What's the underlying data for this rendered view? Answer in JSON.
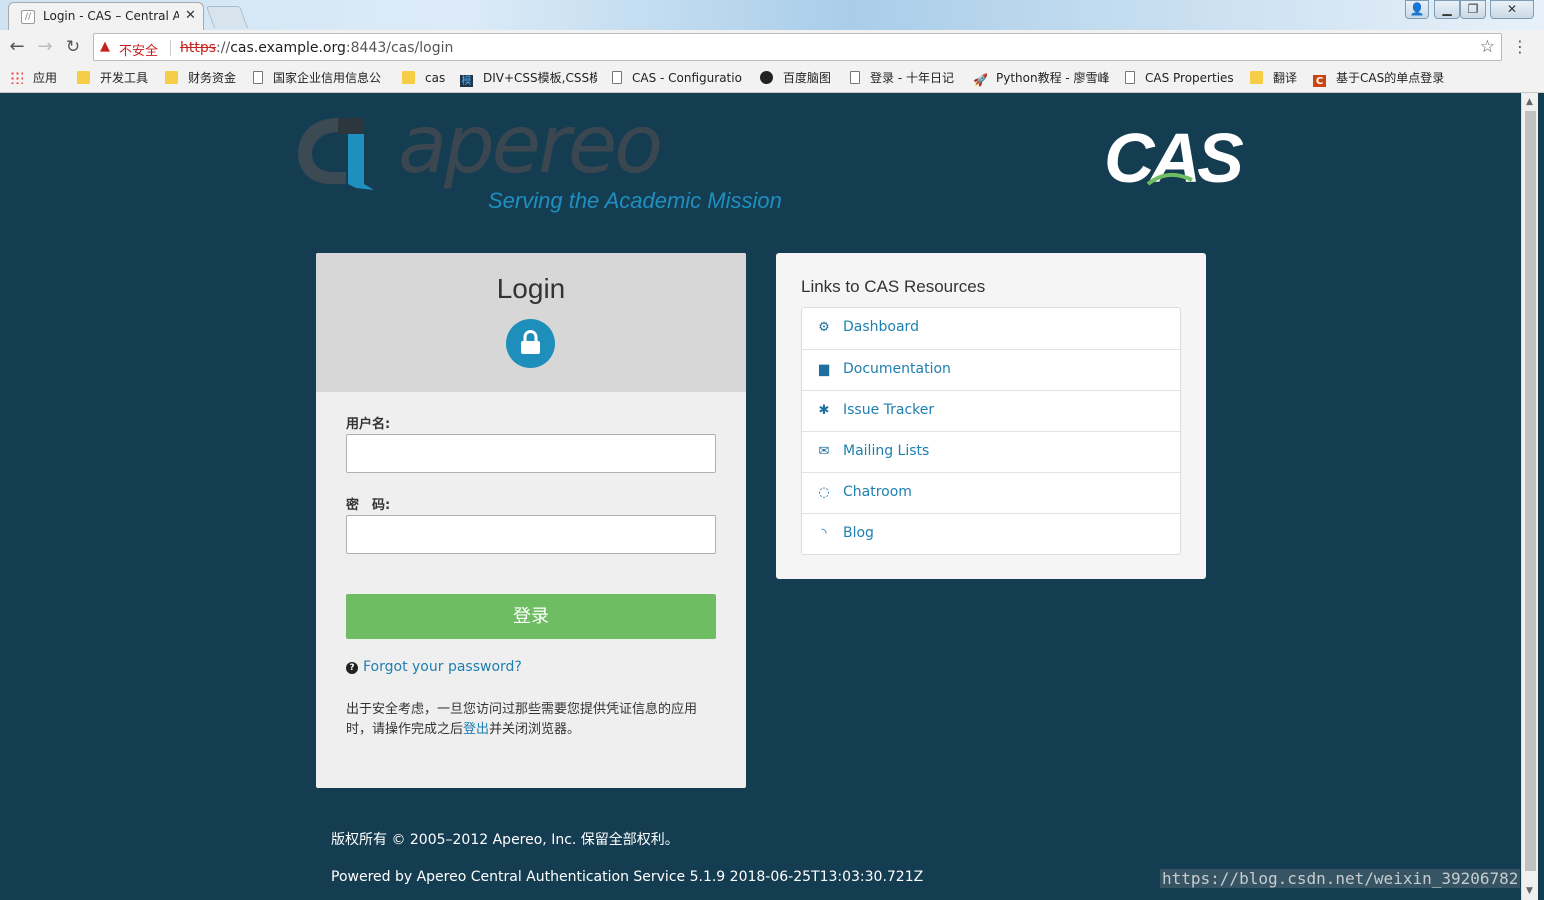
{
  "browser": {
    "tab_title": "Login - CAS – Central A",
    "security_label": "不安全",
    "url_scheme": "https",
    "url_sep": "://",
    "url_host": "cas.example.org",
    "url_rest": ":8443/cas/login",
    "bookmarks": [
      {
        "label": "应用",
        "icon": "apps-icon"
      },
      {
        "label": "开发工具",
        "icon": "folder-icon"
      },
      {
        "label": "财务资金",
        "icon": "folder-icon"
      },
      {
        "label": "国家企业信用信息公",
        "icon": "page-icon"
      },
      {
        "label": "cas",
        "icon": "folder-icon"
      },
      {
        "label": "DIV+CSS模板,CSS模",
        "icon": "template-icon"
      },
      {
        "label": "CAS - Configuratio",
        "icon": "page-icon"
      },
      {
        "label": "百度脑图",
        "icon": "owl-icon"
      },
      {
        "label": "登录 - 十年日记",
        "icon": "page-icon"
      },
      {
        "label": "Python教程 - 廖雪峰",
        "icon": "rocket-icon"
      },
      {
        "label": "CAS Properties",
        "icon": "page-icon"
      },
      {
        "label": "翻译",
        "icon": "folder-icon"
      },
      {
        "label": "基于CAS的单点登录",
        "icon": "c-icon"
      }
    ]
  },
  "header": {
    "apereo_word": "apereo",
    "apereo_tagline": "Serving the Academic Mission",
    "cas_word": "CAS"
  },
  "login": {
    "title": "Login",
    "username_label": "用户名:",
    "username_value": "",
    "password_label": "密　码:",
    "password_value": "",
    "submit_label": "登录",
    "forgot_label": "Forgot your password?",
    "note_before": "出于安全考虑，一旦您访问过那些需要您提供凭证信息的应用时，请操作完成之后",
    "note_link": "登出",
    "note_after": "并关闭浏览器。"
  },
  "resources": {
    "title": "Links to CAS Resources",
    "items": [
      {
        "label": "Dashboard",
        "icon": "gears-icon"
      },
      {
        "label": "Documentation",
        "icon": "file-icon"
      },
      {
        "label": "Issue Tracker",
        "icon": "bug-icon"
      },
      {
        "label": "Mailing Lists",
        "icon": "envelope-icon"
      },
      {
        "label": "Chatroom",
        "icon": "chat-icon"
      },
      {
        "label": "Blog",
        "icon": "rss-icon"
      }
    ]
  },
  "footer": {
    "copyright": "版权所有 © 2005–2012 Apereo, Inc. 保留全部权利。",
    "powered": "Powered by Apereo Central Authentication Service 5.1.9 2018-06-25T13:03:30.721Z",
    "watermark": "https://blog.csdn.net/weixin_39206782"
  },
  "colors": {
    "page_bg": "#153d52",
    "accent_blue": "#1e8ebb",
    "submit_green": "#6fbd63",
    "link_blue": "#1e7fb0"
  }
}
